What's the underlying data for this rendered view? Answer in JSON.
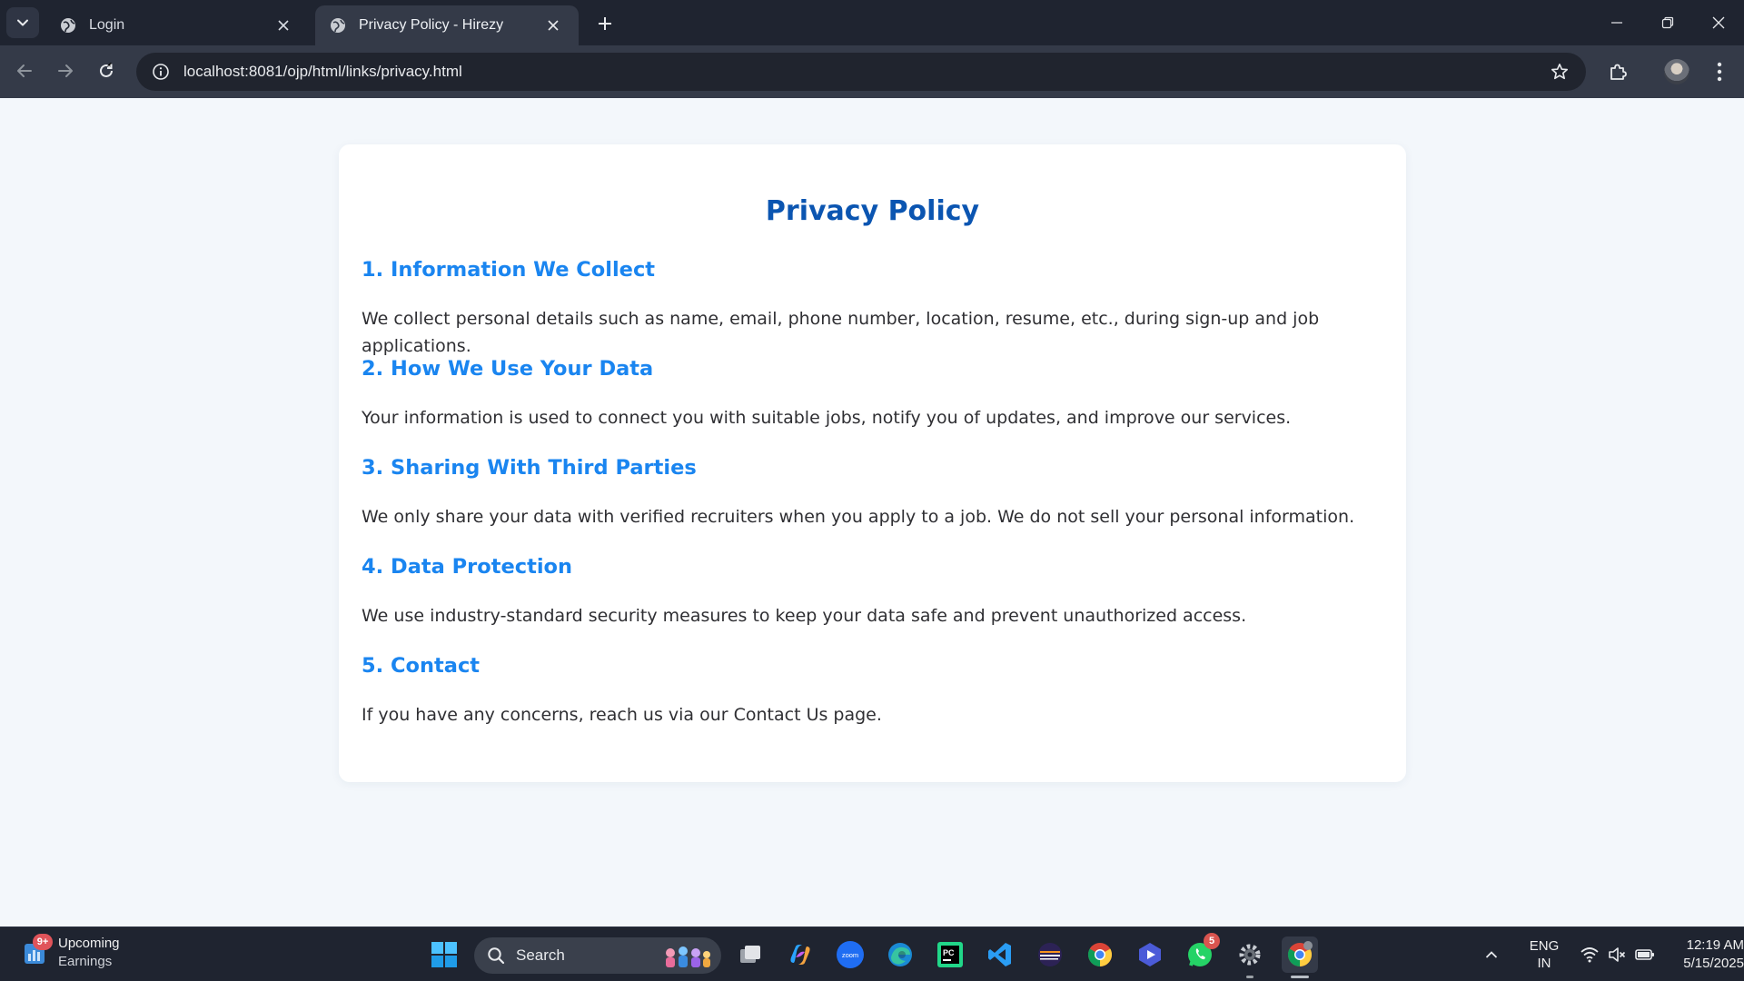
{
  "browser": {
    "tabs": [
      {
        "title": "Login",
        "active": false
      },
      {
        "title": "Privacy Policy - Hirezy",
        "active": true
      }
    ],
    "url": "localhost:8081/ojp/html/links/privacy.html"
  },
  "page": {
    "title": "Privacy Policy",
    "sections": [
      {
        "heading": "1. Information We Collect",
        "text": "We collect personal details such as name, email, phone number, location, resume, etc., during sign-up and job applications."
      },
      {
        "heading": "2. How We Use Your Data",
        "text": "Your information is used to connect you with suitable jobs, notify you of updates, and improve our services."
      },
      {
        "heading": "3. Sharing With Third Parties",
        "text": "We only share your data with verified recruiters when you apply to a job. We do not sell your personal information."
      },
      {
        "heading": "4. Data Protection",
        "text": "We use industry-standard security measures to keep your data safe and prevent unauthorized access."
      },
      {
        "heading": "5. Contact",
        "text": "If you have any concerns, reach us via our Contact Us page."
      }
    ]
  },
  "taskbar": {
    "widget": {
      "badge": "9+",
      "line1": "Upcoming",
      "line2": "Earnings"
    },
    "search_label": "Search",
    "whatsapp_badge": "5",
    "language": {
      "line1": "ENG",
      "line2": "IN"
    },
    "clock": {
      "time": "12:19 AM",
      "date": "5/15/2025"
    }
  },
  "colors": {
    "title": "#0b55b1",
    "heading": "#1a85f0",
    "body_text": "#2f2f33",
    "page_bg": "#f3f7fb",
    "chrome_dark": "#1f2430"
  }
}
